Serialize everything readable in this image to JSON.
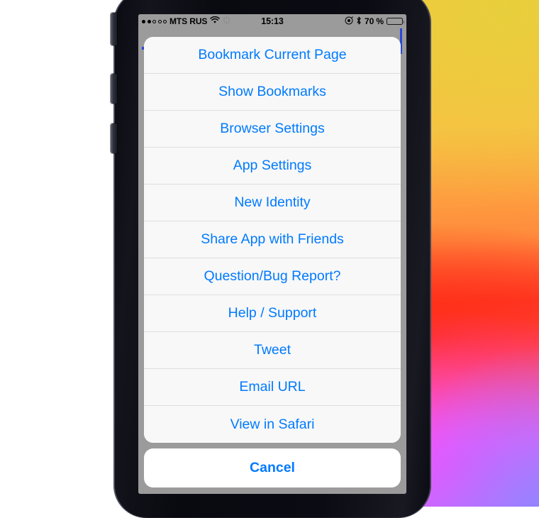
{
  "status_bar": {
    "signal_dots_filled": 2,
    "signal_dots_total": 5,
    "carrier": "MTS RUS",
    "wifi_icon": "wifi-icon",
    "sync_icon": "sync-spinner-icon",
    "time": "15:13",
    "location_icon": "location-services-icon",
    "bluetooth_icon": "bluetooth-icon",
    "battery_percent": "70 %",
    "battery_level": 70
  },
  "action_sheet": {
    "items": [
      {
        "label": "Bookmark Current Page"
      },
      {
        "label": "Show Bookmarks"
      },
      {
        "label": "Browser Settings"
      },
      {
        "label": "App Settings"
      },
      {
        "label": "New Identity"
      },
      {
        "label": "Share App with Friends"
      },
      {
        "label": "Question/Bug Report?"
      },
      {
        "label": "Help / Support"
      },
      {
        "label": "Tweet"
      },
      {
        "label": "Email URL"
      },
      {
        "label": "View in Safari"
      }
    ],
    "cancel_label": "Cancel"
  },
  "colors": {
    "accent_blue": "#007AFF",
    "sheet_background": "#F7F7F7",
    "cancel_background": "#FFFFFF",
    "dimmed_overlay": "#9B9B9B",
    "separator": "#DEDEDE"
  }
}
